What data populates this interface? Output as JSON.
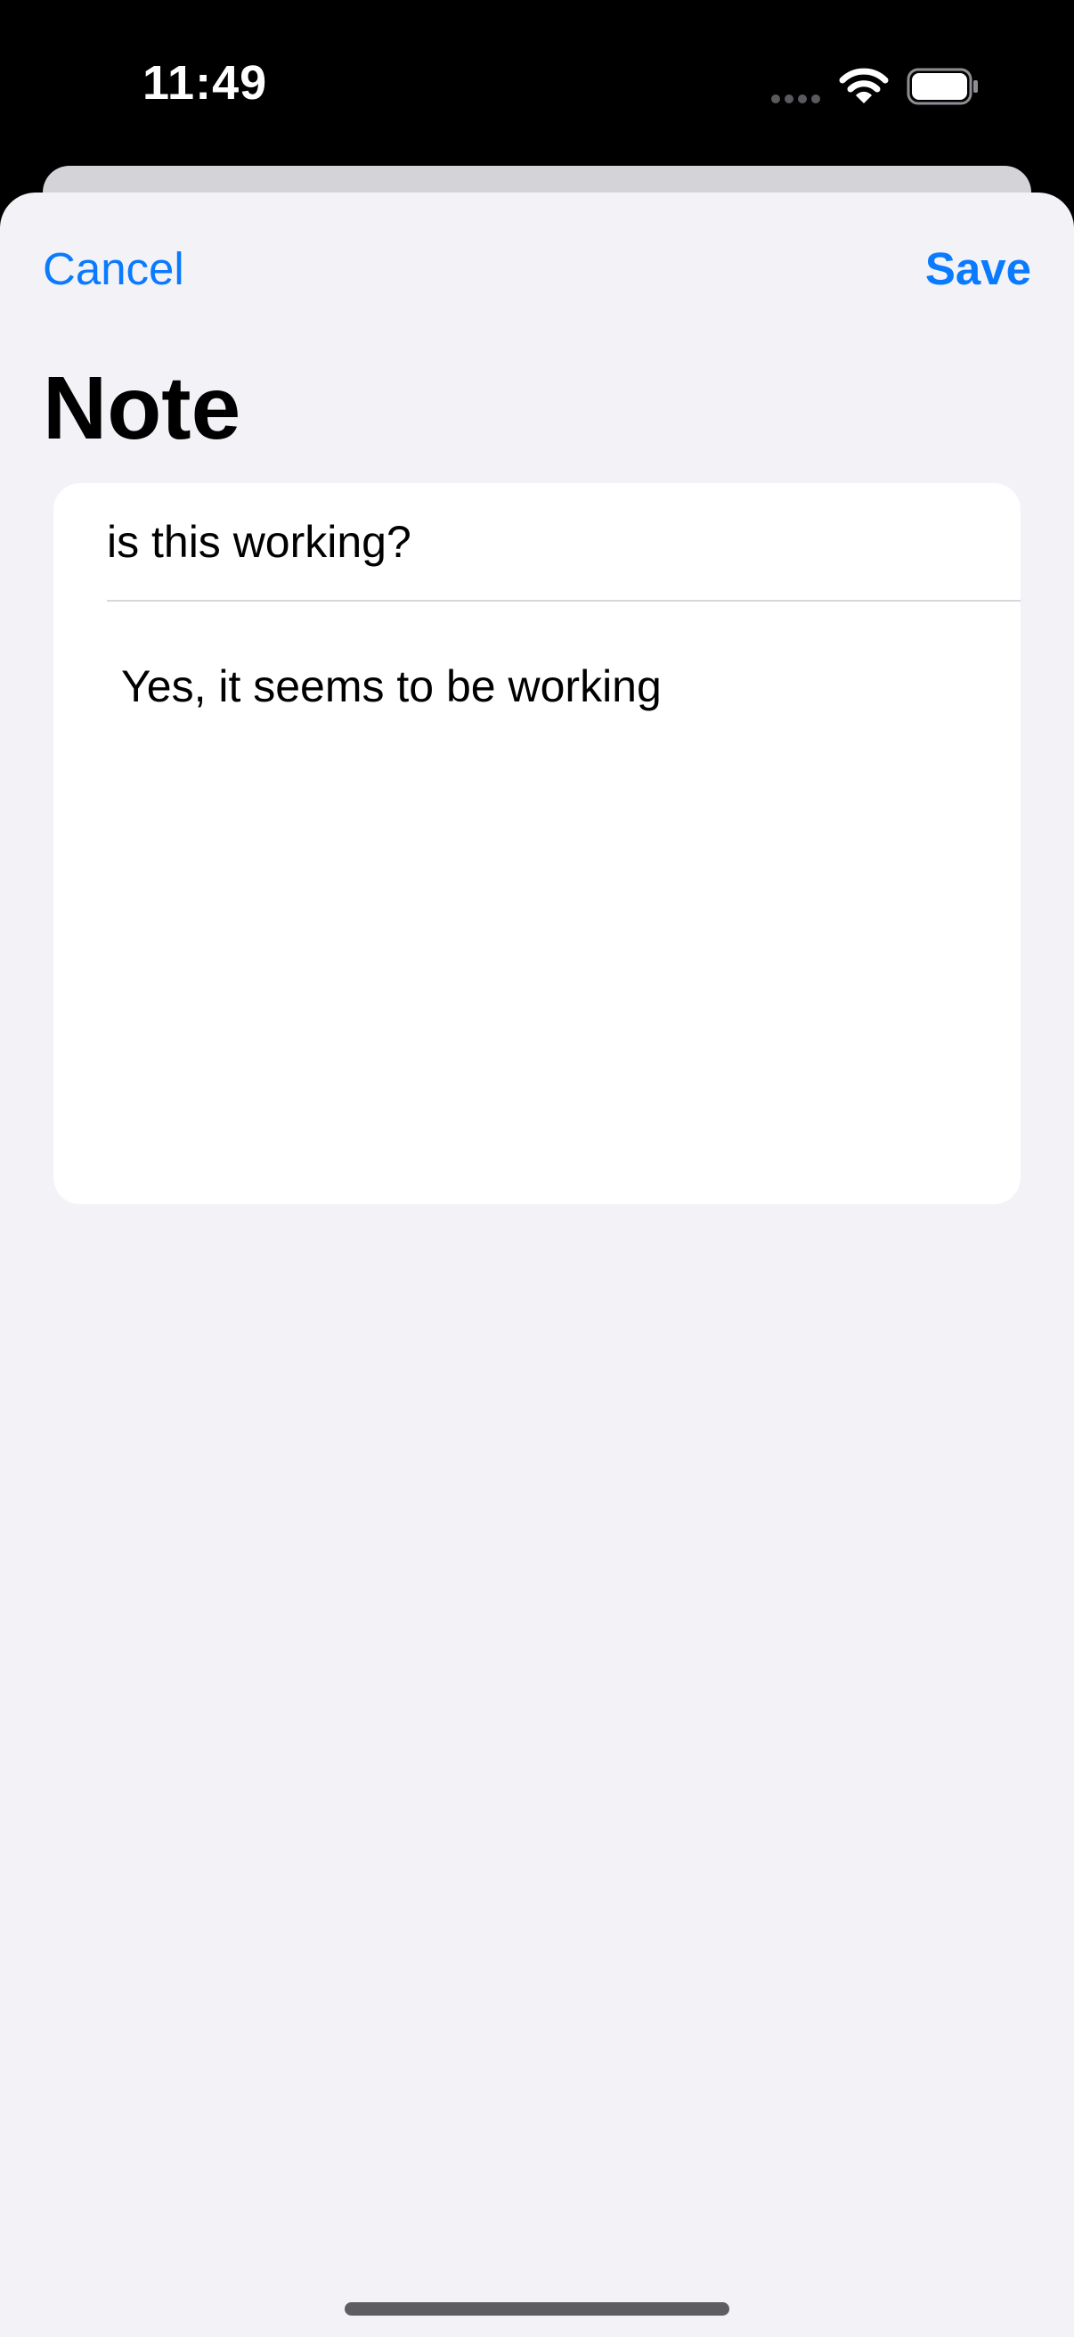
{
  "status_bar": {
    "time": "11:49",
    "icons": [
      "cellular-signal-icon",
      "wifi-icon",
      "battery-icon"
    ]
  },
  "nav": {
    "cancel_label": "Cancel",
    "save_label": "Save"
  },
  "page": {
    "title": "Note"
  },
  "note": {
    "title_value": "is this working?",
    "body_value": "Yes, it seems to be working"
  },
  "colors": {
    "accent": "#0a7aff",
    "sheet_background": "#f2f2f7",
    "card_background": "#ffffff",
    "status_bar_background": "#000000"
  }
}
